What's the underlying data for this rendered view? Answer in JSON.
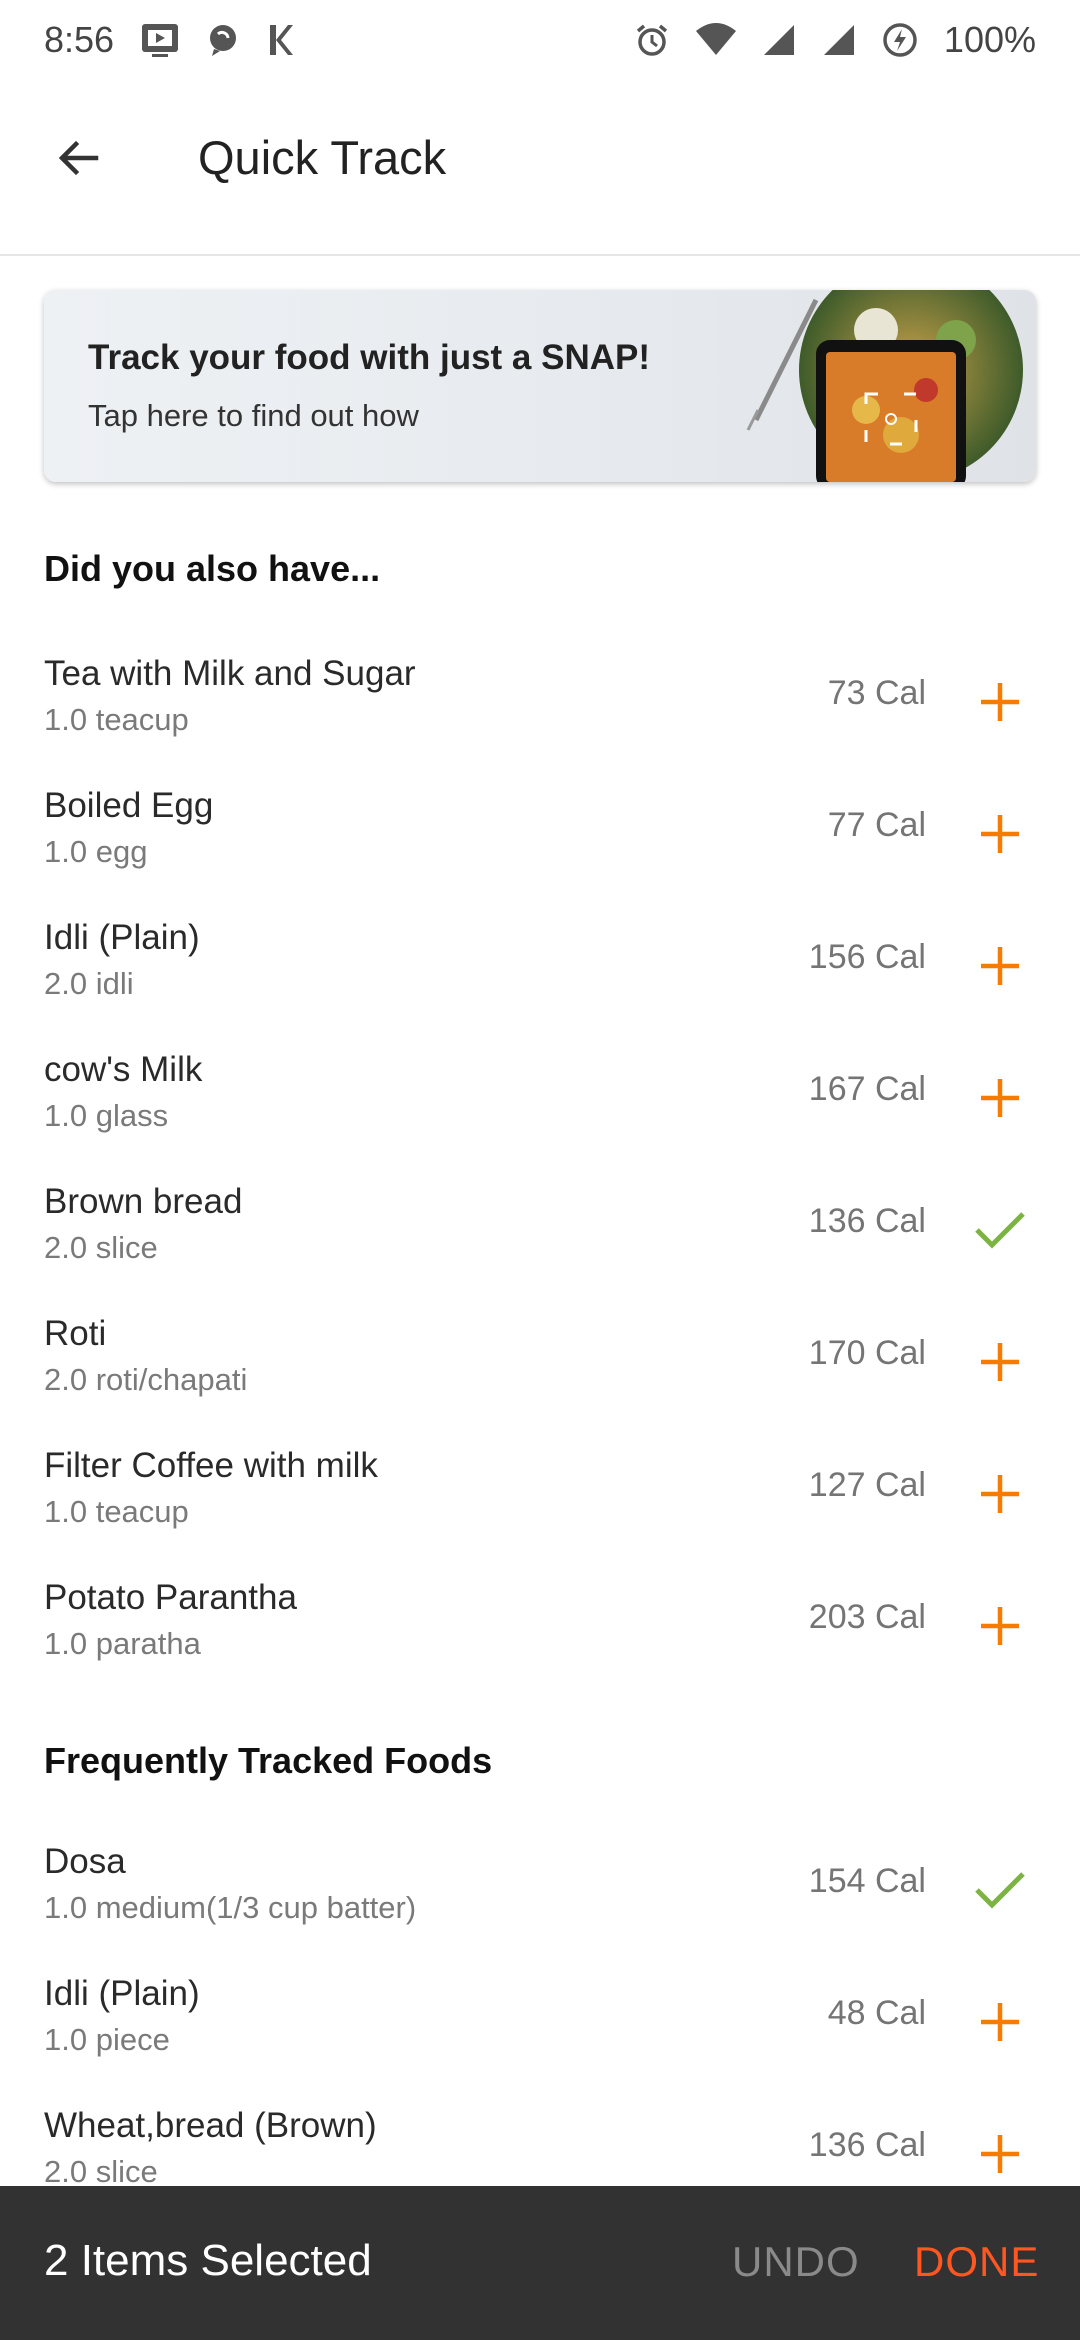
{
  "status_bar": {
    "time": "8:56",
    "battery": "100%",
    "icons": [
      "tv-icon",
      "chat-icon",
      "k-icon",
      "alarm-icon",
      "wifi-icon",
      "signal-icon",
      "signal-icon",
      "battery-saver-icon"
    ]
  },
  "app_bar": {
    "title": "Quick Track",
    "back_icon": "arrow-back-icon"
  },
  "banner": {
    "title": "Track your food with just a SNAP!",
    "subtitle": "Tap here to find out how"
  },
  "sections": [
    {
      "header": "Did you also have...",
      "items": [
        {
          "name": "Tea with Milk and Sugar",
          "qty": "1.0 teacup",
          "cal": "73 Cal",
          "selected": false
        },
        {
          "name": "Boiled Egg",
          "qty": "1.0 egg",
          "cal": "77 Cal",
          "selected": false
        },
        {
          "name": "Idli (Plain)",
          "qty": "2.0 idli",
          "cal": "156 Cal",
          "selected": false
        },
        {
          "name": "cow's Milk",
          "qty": "1.0 glass",
          "cal": "167 Cal",
          "selected": false
        },
        {
          "name": "Brown bread",
          "qty": "2.0 slice",
          "cal": "136 Cal",
          "selected": true
        },
        {
          "name": "Roti",
          "qty": "2.0 roti/chapati",
          "cal": "170 Cal",
          "selected": false
        },
        {
          "name": "Filter Coffee with milk",
          "qty": "1.0 teacup",
          "cal": "127 Cal",
          "selected": false
        },
        {
          "name": "Potato Parantha",
          "qty": "1.0 paratha",
          "cal": "203 Cal",
          "selected": false
        }
      ]
    },
    {
      "header": "Frequently Tracked Foods",
      "items": [
        {
          "name": "Dosa",
          "qty": "1.0 medium(1/3 cup batter)",
          "cal": "154 Cal",
          "selected": true
        },
        {
          "name": "Idli (Plain)",
          "qty": "1.0 piece",
          "cal": "48 Cal",
          "selected": false
        },
        {
          "name": "Wheat,bread (Brown)",
          "qty": "2.0 slice",
          "cal": "136 Cal",
          "selected": false
        }
      ]
    }
  ],
  "snackbar": {
    "text": "2 Items Selected",
    "undo": "UNDO",
    "done": "DONE"
  },
  "colors": {
    "accent_orange": "#f57c00",
    "check_green": "#7cb342",
    "done_orange": "#ff5722"
  }
}
